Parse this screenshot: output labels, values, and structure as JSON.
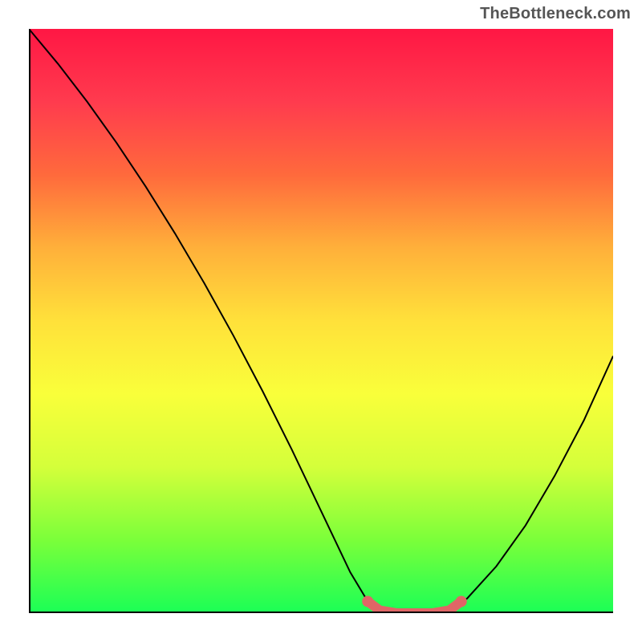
{
  "watermark": "TheBottleneck.com",
  "colors": {
    "gradient_stops": [
      "#ff1744",
      "#ff3b4e",
      "#ff6a3c",
      "#ffb03a",
      "#ffe13a",
      "#f9ff3a",
      "#d4ff3a",
      "#7bff3a",
      "#1aff56"
    ],
    "curve": "#000000",
    "accent": "#e06666",
    "axis": "#000000"
  },
  "chart_data": {
    "type": "line",
    "title": "",
    "xlabel": "",
    "ylabel": "",
    "xlim": [
      0,
      100
    ],
    "ylim": [
      0,
      100
    ],
    "grid": false,
    "legend": false,
    "series": [
      {
        "name": "bottleneck-curve",
        "x": [
          0,
          5,
          10,
          15,
          20,
          25,
          30,
          35,
          40,
          45,
          50,
          55,
          58,
          60,
          63,
          66,
          69,
          72,
          75,
          80,
          85,
          90,
          95,
          100
        ],
        "y": [
          100,
          94,
          87.5,
          80.5,
          73,
          65,
          56.5,
          47.5,
          38,
          28,
          17.5,
          7,
          2,
          0.5,
          0,
          0,
          0,
          0.5,
          2.5,
          8,
          15,
          23.5,
          33,
          44
        ]
      }
    ],
    "accent_segment": {
      "name": "optimal-range",
      "x": [
        58,
        60,
        63,
        66,
        69,
        72,
        74
      ],
      "y": [
        2,
        0.5,
        0,
        0,
        0,
        0.5,
        2
      ]
    }
  }
}
